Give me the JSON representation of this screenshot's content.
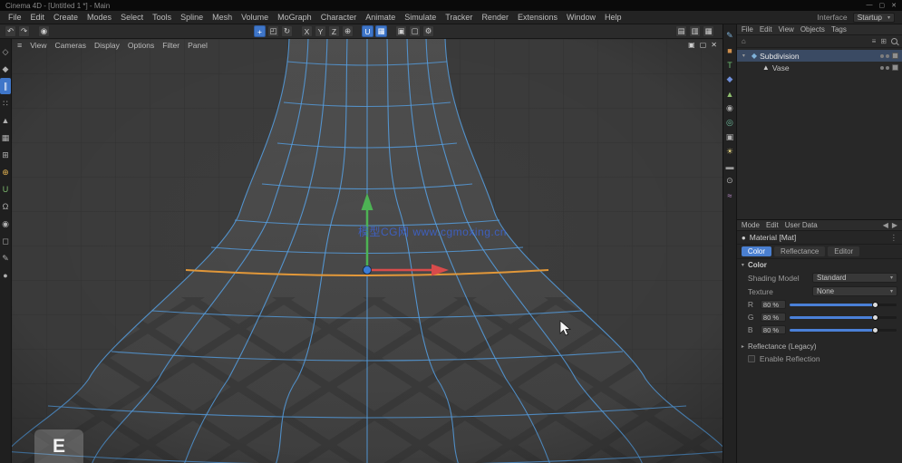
{
  "window": {
    "title": "Cinema 4D - [Untitled 1 *] - Main",
    "controls": [
      "—",
      "▢",
      "✕"
    ]
  },
  "menubar": {
    "items": [
      "File",
      "Edit",
      "Create",
      "Modes",
      "Select",
      "Tools",
      "Spline",
      "Mesh",
      "Volume",
      "MoGraph",
      "Character",
      "Animate",
      "Simulate",
      "Tracker",
      "Render",
      "Extensions",
      "Window",
      "Help"
    ],
    "right": {
      "label": "Interface",
      "value": "Startup",
      "arrow": "▾"
    }
  },
  "toolbar": {
    "left": [
      {
        "name": "undo-icon",
        "glyph": "↶"
      },
      {
        "name": "redo-icon",
        "glyph": "↷"
      },
      {
        "sep": true
      },
      {
        "name": "live-selection-icon",
        "glyph": "◉"
      }
    ],
    "center": [
      {
        "name": "move-tool-icon",
        "glyph": "+",
        "active": true
      },
      {
        "name": "scale-tool-icon",
        "glyph": "◰"
      },
      {
        "name": "rotate-tool-icon",
        "glyph": "↻"
      },
      {
        "sep": true
      },
      {
        "name": "axis-x-icon",
        "glyph": "X"
      },
      {
        "name": "axis-y-icon",
        "glyph": "Y"
      },
      {
        "name": "axis-z-icon",
        "glyph": "Z"
      },
      {
        "name": "coord-system-icon",
        "glyph": "⊕"
      },
      {
        "sep": true
      },
      {
        "name": "snap-icon",
        "glyph": "U",
        "active": true
      },
      {
        "name": "workplane-icon",
        "glyph": "▦",
        "active": true
      },
      {
        "sep": true
      },
      {
        "name": "render-view-icon",
        "glyph": "▣"
      },
      {
        "name": "render-picture-viewer-icon",
        "glyph": "▢"
      },
      {
        "name": "render-settings-icon",
        "glyph": "⚙"
      }
    ],
    "right": [
      {
        "name": "layout-icon-1",
        "glyph": "▤"
      },
      {
        "name": "layout-icon-2",
        "glyph": "▥"
      },
      {
        "name": "layout-icon-3",
        "glyph": "▦"
      }
    ]
  },
  "left_toolbar": [
    {
      "name": "make-editable-icon",
      "glyph": "◇"
    },
    {
      "name": "model-mode-icon",
      "glyph": "◆"
    },
    {
      "name": "edge-mode-icon",
      "glyph": "∥",
      "active": true
    },
    {
      "name": "points-mode-icon",
      "glyph": "∷"
    },
    {
      "name": "polygons-mode-icon",
      "glyph": "▲"
    },
    {
      "name": "texture-mode-icon",
      "glyph": "▦"
    },
    {
      "name": "workplane-mode-icon",
      "glyph": "⊞"
    },
    {
      "name": "enable-axis-icon",
      "glyph": "⊕",
      "color": "#e0b050"
    },
    {
      "name": "snap-toggle-icon",
      "glyph": "U",
      "color": "#7cb96d"
    },
    {
      "name": "quantize-icon",
      "glyph": "Ω"
    },
    {
      "name": "solo-icon",
      "glyph": "◉"
    },
    {
      "name": "viewport-filter-icon",
      "glyph": "◻"
    },
    {
      "name": "annotate-icon",
      "glyph": "✎"
    },
    {
      "name": "measure-icon",
      "glyph": "●"
    }
  ],
  "viewport": {
    "burger": "≡",
    "menu": [
      "View",
      "Cameras",
      "Display",
      "Options",
      "Filter",
      "Panel"
    ],
    "corner_icons": [
      {
        "name": "viewport-pin-icon",
        "glyph": "▣"
      },
      {
        "name": "viewport-maximize-icon",
        "glyph": "▢"
      },
      {
        "name": "viewport-close-icon",
        "glyph": "✕"
      }
    ],
    "watermark": "模型CG网 www.cgmoxing.cn",
    "key_overlay": "E",
    "colors": {
      "wire": "#57a3e8",
      "selected_edge": "#e59a3a",
      "gizmo_x": "#d84b4b",
      "gizmo_y": "#4db354",
      "gizmo_z": "#3a7bd5",
      "watermark": "#3c63d2",
      "slider": "#4a80d8"
    }
  },
  "right_rail": [
    {
      "name": "spline-pen-icon",
      "glyph": "✎",
      "color": "#7fb2d9"
    },
    {
      "name": "cube-icon",
      "glyph": "■",
      "color": "#cf8f4e"
    },
    {
      "name": "text-icon",
      "glyph": "T",
      "color": "#6fbf73"
    },
    {
      "name": "subdivision-surface-icon",
      "glyph": "◆",
      "color": "#6f8fd9"
    },
    {
      "name": "extrude-icon",
      "glyph": "▲",
      "color": "#8fbf6f"
    },
    {
      "name": "volume-icon",
      "glyph": "◉",
      "color": "#a8a8a8"
    },
    {
      "name": "field-icon",
      "glyph": "◎",
      "color": "#6fbf9f"
    },
    {
      "name": "camera-icon",
      "glyph": "▣",
      "color": "#b0b0b0"
    },
    {
      "name": "light-icon",
      "glyph": "☀",
      "color": "#e0d080"
    },
    {
      "name": "floor-icon",
      "glyph": "▬",
      "color": "#9a9a9a"
    },
    {
      "name": "null-object-icon",
      "glyph": "⊙",
      "color": "#b0b0b0"
    },
    {
      "name": "bend-deformer-icon",
      "glyph": "≈",
      "color": "#c08fd0"
    }
  ],
  "outliner": {
    "menus": [
      "File",
      "Edit",
      "View",
      "Objects",
      "Tags"
    ],
    "objects": [
      {
        "name": "Subdivision",
        "icon": "◆",
        "iconColor": "#7fb2d9",
        "expander": "▾",
        "active": true
      },
      {
        "name": "Vase",
        "icon": "▲",
        "iconColor": "#c9c9c9",
        "expander": "",
        "indent": 1
      }
    ]
  },
  "attributes": {
    "menus": [
      "Mode",
      "Edit",
      "User Data"
    ],
    "nav": [
      "◀",
      "▶"
    ],
    "breadcrumb": {
      "icon": "●",
      "label": "Material [Mat]",
      "more": "⋮"
    },
    "tabs": [
      {
        "label": "Color",
        "active": true
      },
      {
        "label": "Reflectance"
      },
      {
        "label": "Editor"
      }
    ],
    "section": {
      "tri": "▾",
      "label": "Color"
    },
    "dropdowns": [
      {
        "label": "Shading Model",
        "value": "Standard",
        "arrow": "▾"
      },
      {
        "label": "Texture",
        "value": "None",
        "arrow": "▾"
      }
    ],
    "sliders": [
      {
        "label": "R",
        "value": "80 %",
        "pct": 80
      },
      {
        "label": "G",
        "value": "80 %",
        "pct": 80
      },
      {
        "label": "B",
        "value": "80 %",
        "pct": 80
      }
    ],
    "collapsed": {
      "tri": "▸",
      "label": "Reflectance (Legacy)"
    },
    "checkbox": {
      "label": "Enable Reflection"
    }
  }
}
